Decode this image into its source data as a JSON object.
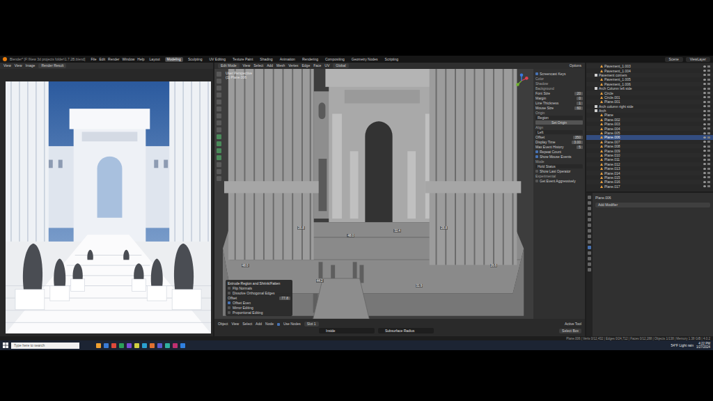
{
  "window": {
    "title": "Blender* [F:\\New 3d projects folder\\1.7.2B.blend]"
  },
  "menu": [
    "File",
    "Edit",
    "Render",
    "Window",
    "Help"
  ],
  "workspaces": [
    {
      "label": "Layout",
      "selected": false
    },
    {
      "label": "Modeling",
      "selected": true
    },
    {
      "label": "Sculpting",
      "selected": false
    },
    {
      "label": "UV Editing",
      "selected": false
    },
    {
      "label": "Texture Paint",
      "selected": false
    },
    {
      "label": "Shading",
      "selected": false
    },
    {
      "label": "Animation",
      "selected": false
    },
    {
      "label": "Rendering",
      "selected": false
    },
    {
      "label": "Compositing",
      "selected": false
    },
    {
      "label": "Geometry Nodes",
      "selected": false
    },
    {
      "label": "Scripting",
      "selected": false
    }
  ],
  "scene": "Scene",
  "view_layer": "ViewLayer",
  "image_editor": {
    "menus": [
      "View",
      "View",
      "Image"
    ],
    "slot": "Render Result"
  },
  "viewport": {
    "mode": "Edit Mode",
    "menus": [
      "View",
      "Select",
      "Add",
      "Mesh",
      "Vertex",
      "Edge",
      "Face",
      "UV"
    ],
    "orientation": "Global",
    "options": "Options",
    "info": [
      "User Perspective",
      "(1) Plane.006"
    ]
  },
  "measurements": [
    "26.8",
    "48.0",
    "32.4",
    "26.8",
    "48.0",
    "26.6",
    "44.2",
    "31.9"
  ],
  "operator_panel": {
    "title": "Extrude Region and Shrink/Fatten",
    "items": [
      {
        "kind": "check",
        "label": "Flip Normals",
        "checked": false
      },
      {
        "kind": "check",
        "label": "Dissolve Orthogonal Edges",
        "checked": false
      },
      {
        "kind": "field",
        "label": "Offset",
        "value": "77.8"
      },
      {
        "kind": "check",
        "label": "Offset Even",
        "checked": true
      },
      {
        "kind": "check",
        "label": "Mirror Editing",
        "checked": false
      },
      {
        "kind": "check",
        "label": "Proportional Editing",
        "checked": false
      }
    ]
  },
  "npanel": {
    "items": [
      {
        "kind": "check",
        "label": "Screencast Keys",
        "checked": true
      },
      {
        "kind": "label",
        "label": "Color"
      },
      {
        "kind": "label",
        "label": "Shadow"
      },
      {
        "kind": "label",
        "label": "Background"
      },
      {
        "kind": "field",
        "label": "Font Size",
        "value": "20"
      },
      {
        "kind": "field",
        "label": "Margin",
        "value": "0"
      },
      {
        "kind": "field",
        "label": "Line Thickness",
        "value": "1"
      },
      {
        "kind": "field",
        "label": "Mouse Size",
        "value": "60"
      },
      {
        "kind": "label",
        "label": "Origin"
      },
      {
        "kind": "select",
        "value": "Region"
      },
      {
        "kind": "button",
        "label": "Set Origin"
      },
      {
        "kind": "label",
        "label": "Align"
      },
      {
        "kind": "select",
        "value": "Left"
      },
      {
        "kind": "field",
        "label": "Offset",
        "value": "350"
      },
      {
        "kind": "field",
        "label": "Display Time",
        "value": "3.00"
      },
      {
        "kind": "field",
        "label": "Max Event History",
        "value": "5"
      },
      {
        "kind": "check",
        "label": "Repeat Count",
        "checked": true
      },
      {
        "kind": "check",
        "label": "Show Mouse Events",
        "checked": true
      },
      {
        "kind": "label",
        "label": "Mode"
      },
      {
        "kind": "select",
        "value": "Hold Status"
      },
      {
        "kind": "check",
        "label": "Show Last Operator",
        "checked": false
      },
      {
        "kind": "label",
        "label": "Experimental"
      },
      {
        "kind": "check",
        "label": "Get Event Aggressively",
        "checked": false
      }
    ]
  },
  "outliner": {
    "items": [
      {
        "label": "Pavement_1.003",
        "depth": 2,
        "selected": false
      },
      {
        "label": "Pavement_1.004",
        "depth": 2,
        "selected": false
      },
      {
        "label": "Pavement corners",
        "depth": 1,
        "selected": false
      },
      {
        "label": "Pavement_1.005",
        "depth": 2,
        "selected": false
      },
      {
        "label": "Pavement_1.006",
        "depth": 2,
        "selected": false
      },
      {
        "label": "Arch Column left side",
        "depth": 1,
        "selected": false
      },
      {
        "label": "Circle",
        "depth": 2,
        "selected": false
      },
      {
        "label": "Circle.001",
        "depth": 2,
        "selected": false
      },
      {
        "label": "Plane.001",
        "depth": 2,
        "selected": false
      },
      {
        "label": "Arch column right side",
        "depth": 1,
        "selected": false
      },
      {
        "label": "Arch",
        "depth": 1,
        "selected": false
      },
      {
        "label": "Plane",
        "depth": 2,
        "selected": false
      },
      {
        "label": "Plane.002",
        "depth": 2,
        "selected": false
      },
      {
        "label": "Plane.003",
        "depth": 2,
        "selected": false
      },
      {
        "label": "Plane.004",
        "depth": 2,
        "selected": false
      },
      {
        "label": "Plane.005",
        "depth": 2,
        "selected": false
      },
      {
        "label": "Plane.006",
        "depth": 2,
        "selected": true
      },
      {
        "label": "Plane.007",
        "depth": 2,
        "selected": false
      },
      {
        "label": "Plane.008",
        "depth": 2,
        "selected": false
      },
      {
        "label": "Plane.009",
        "depth": 2,
        "selected": false
      },
      {
        "label": "Plane.010",
        "depth": 2,
        "selected": false
      },
      {
        "label": "Plane.011",
        "depth": 2,
        "selected": false
      },
      {
        "label": "Plane.012",
        "depth": 2,
        "selected": false
      },
      {
        "label": "Plane.013",
        "depth": 2,
        "selected": false
      },
      {
        "label": "Plane.014",
        "depth": 2,
        "selected": false
      },
      {
        "label": "Plane.015",
        "depth": 2,
        "selected": false
      },
      {
        "label": "Plane.016",
        "depth": 2,
        "selected": false
      },
      {
        "label": "Plane.017",
        "depth": 2,
        "selected": false
      }
    ]
  },
  "properties": {
    "object": "Plane.006",
    "button": "Add Modifier"
  },
  "timeline": {
    "menus": [
      "Object",
      "View",
      "Select",
      "Add",
      "Node"
    ],
    "use_nodes": {
      "label": "Use Nodes",
      "checked": true
    },
    "slot": "Slot 1",
    "fields": [
      "Inside",
      "Subsurface Radius"
    ],
    "active_tool": "Active Tool",
    "tool": "Select Box"
  },
  "status_bar": "Plane.006 | Verts 0/12,432 | Edges 0/24,712 | Faces 0/12,288 | Objects 1/138 | Memory 1.38 GiB | 4.0.2",
  "taskbar": {
    "search": "Type here to search",
    "weather": "54°F  Light rain",
    "time": "4:22 PM",
    "date": "1/27/2024"
  }
}
